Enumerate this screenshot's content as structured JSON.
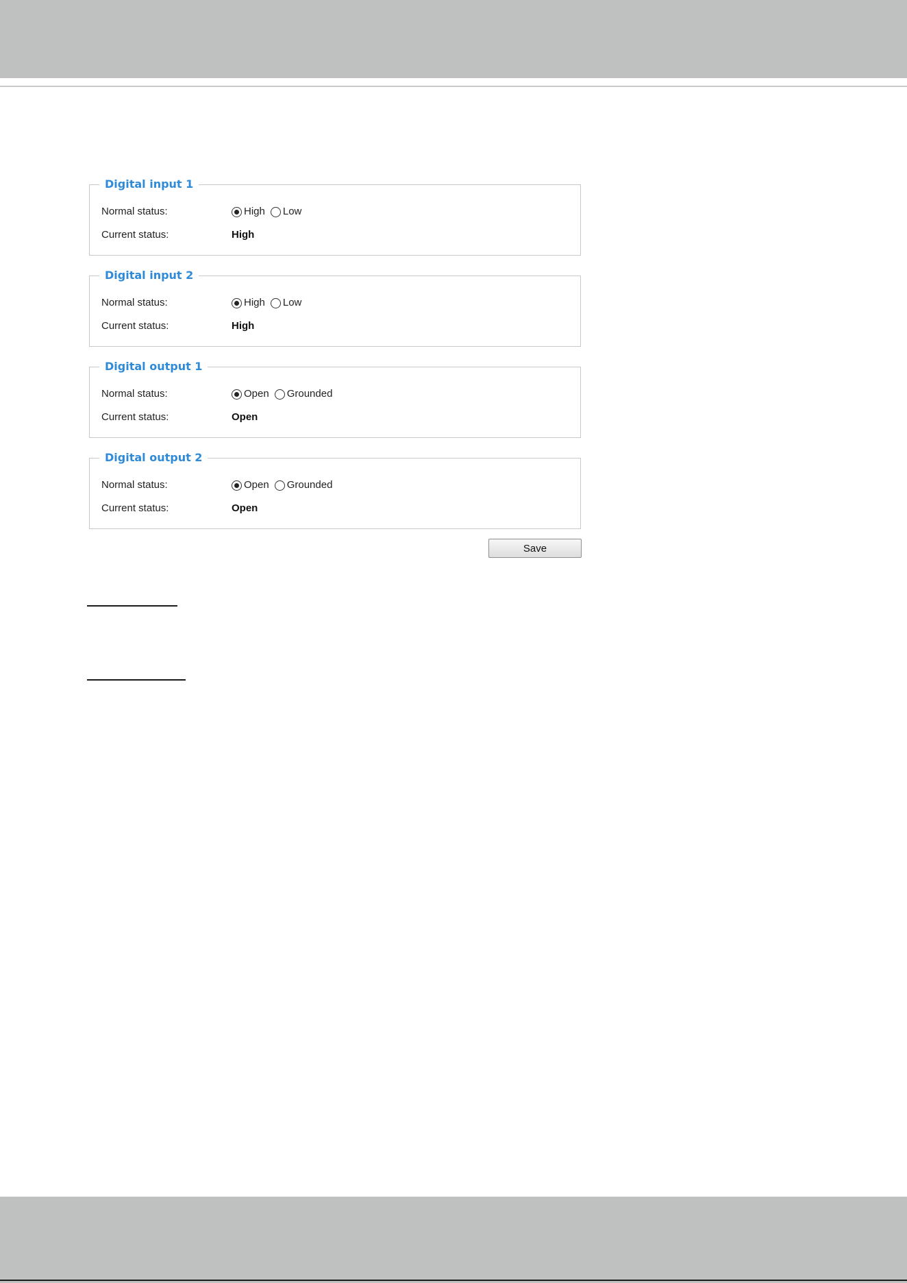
{
  "panels": [
    {
      "title": "Digital input 1",
      "normal_label": "Normal status:",
      "options": [
        {
          "label": "High",
          "checked": true
        },
        {
          "label": "Low",
          "checked": false
        }
      ],
      "current_label": "Current status:",
      "current_value": "High"
    },
    {
      "title": "Digital input 2",
      "normal_label": "Normal status:",
      "options": [
        {
          "label": "High",
          "checked": true
        },
        {
          "label": "Low",
          "checked": false
        }
      ],
      "current_label": "Current status:",
      "current_value": "High"
    },
    {
      "title": "Digital output 1",
      "normal_label": "Normal status:",
      "options": [
        {
          "label": "Open",
          "checked": true
        },
        {
          "label": "Grounded",
          "checked": false
        }
      ],
      "current_label": "Current status:",
      "current_value": "Open"
    },
    {
      "title": "Digital output 2",
      "normal_label": "Normal status:",
      "options": [
        {
          "label": "Open",
          "checked": true
        },
        {
          "label": "Grounded",
          "checked": false
        }
      ],
      "current_label": "Current status:",
      "current_value": "Open"
    }
  ],
  "save_label": "Save",
  "colors": {
    "band": "#bfc1c0",
    "title_blue": "#2f8ad8",
    "border": "#c8c8c8"
  }
}
